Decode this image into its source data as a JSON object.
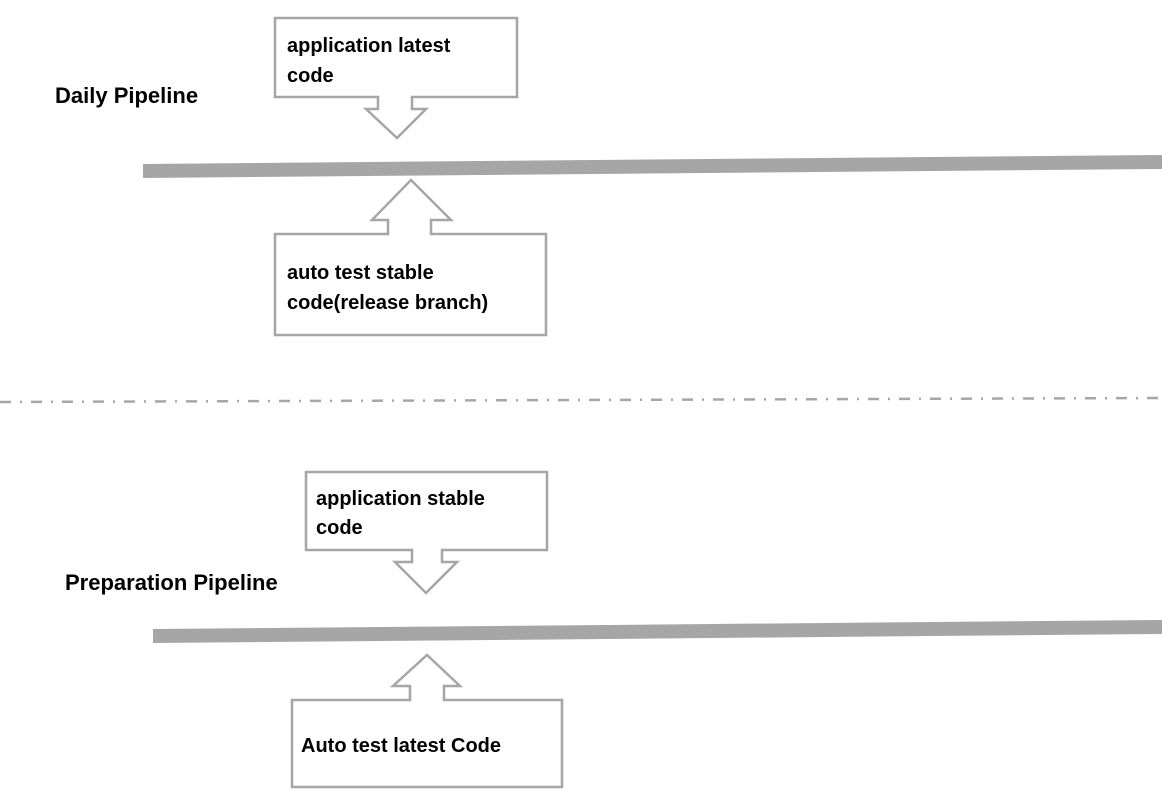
{
  "colors": {
    "bar": "#a6a6a6",
    "outline": "#a6a6a6",
    "separator": "#a6a6a6",
    "text": "#000000"
  },
  "sections": [
    {
      "title": "Daily Pipeline",
      "input_top": {
        "lines": [
          "application latest",
          "code"
        ],
        "arrow": "down-arrow"
      },
      "input_bottom": {
        "lines": [
          "auto test stable",
          "code(release branch)"
        ],
        "arrow": "up-arrow"
      }
    },
    {
      "title": "Preparation Pipeline",
      "input_top": {
        "lines": [
          "application stable",
          "code"
        ],
        "arrow": "down-arrow"
      },
      "input_bottom": {
        "lines": [
          "Auto test latest Code"
        ],
        "arrow": "up-arrow"
      }
    }
  ],
  "separator": {
    "style": "dash-dot"
  }
}
